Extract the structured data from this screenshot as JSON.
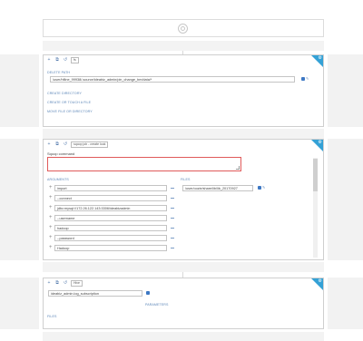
{
  "start_node": {
    "icon": "start-circle-icon"
  },
  "fs_action": {
    "name": "fs",
    "delete_path_label": "DELETE PATH",
    "delete_path_value": "/user/hfline_99938/.source/ideabiz_admin/pin_change_bm/data/*",
    "links": [
      "CREATE DIRECTORY",
      "CREATE OR TOUCH A FILE",
      "MOVE FILE OR DIRECTORY"
    ]
  },
  "sqoop_action": {
    "name": "sqoop job - create look",
    "command_label": "Sqoop command",
    "arguments_label": "ARGUMENTS",
    "files_label": "FILES",
    "arguments": [
      "import",
      "--connect",
      "jdbc:mysql://172.26.122.143:3306/ideabizadmin",
      "--username",
      "hadoop",
      "--password",
      "Hadoop"
    ],
    "file_value": "/user/oozie/share/lib/lib_20170927"
  },
  "hive_action": {
    "name": "Hive",
    "script_value": "ideabiz_admin.log_subscription",
    "parameters_label": "PARAMETERS",
    "files_label": "FILES"
  }
}
